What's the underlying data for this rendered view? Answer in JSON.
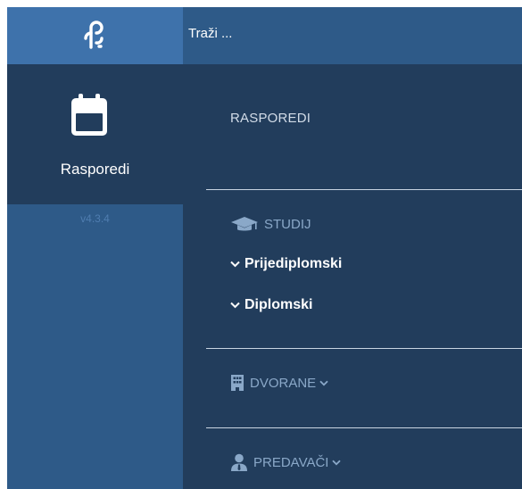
{
  "search": {
    "placeholder": "Traži ..."
  },
  "sidebar": {
    "tile_label": "Rasporedi",
    "version": "v4.3.4"
  },
  "menu": {
    "heading": "RASPOREDI",
    "studij": {
      "label": "STUDIJ",
      "items": [
        {
          "label": "Prijediplomski"
        },
        {
          "label": "Diplomski"
        }
      ]
    },
    "dvorane": {
      "label": "DVORANE"
    },
    "predavaci": {
      "label": "PREDAVAČI"
    }
  },
  "icons": {
    "logo": "app-logo-icon",
    "calendar": "calendar-icon",
    "studij": "graduation-cap-icon",
    "dvorane": "building-icon",
    "predavaci": "user-tie-icon",
    "expand": "chevron-down-icon"
  },
  "colors": {
    "panel": "#223d5c",
    "sidebar": "#2e5a88",
    "logo_bg": "#3e72ab"
  }
}
